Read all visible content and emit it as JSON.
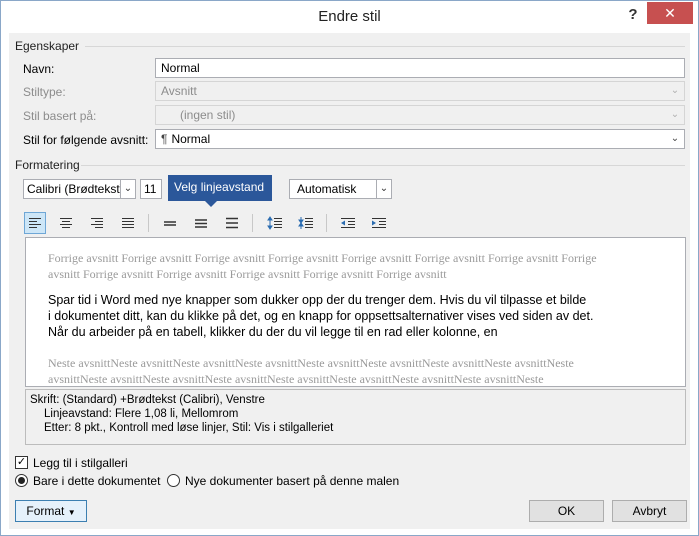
{
  "window": {
    "title": "Endre stil",
    "help_label": "?",
    "close_label": "✕"
  },
  "properties": {
    "section_label": "Egenskaper",
    "name_label": "Navn:",
    "name_value": "Normal",
    "type_label": "Stiltype:",
    "type_value": "Avsnitt",
    "based_on_label": "Stil basert på:",
    "based_on_value": "(ingen stil)",
    "next_label": "Stil for følgende avsnitt:",
    "next_icon": "¶",
    "next_value": "Normal"
  },
  "formatting": {
    "section_label": "Formatering",
    "font_value": "Calibri (Brødtekst)",
    "size_value": "11",
    "color_value": "Automatisk",
    "tooltip": "Velg linjeavstand",
    "toolbar_icons": [
      "align-left-icon",
      "align-center-icon",
      "align-right-icon",
      "justify-icon",
      "single-spacing-icon",
      "one-half-spacing-icon",
      "double-spacing-icon",
      "space-before-increase-icon",
      "space-before-decrease-icon",
      "decrease-indent-icon",
      "increase-indent-icon"
    ]
  },
  "preview": {
    "prev_line1": "Forrige avsnitt Forrige avsnitt Forrige avsnitt Forrige avsnitt Forrige avsnitt Forrige avsnitt Forrige avsnitt Forrige",
    "prev_line2": "avsnitt Forrige avsnitt Forrige avsnitt Forrige avsnitt Forrige avsnitt Forrige avsnitt",
    "main_line1": "Spar tid i Word med nye knapper som dukker opp der du trenger dem. Hvis du vil tilpasse et bilde",
    "main_line2": "i dokumentet ditt, kan du klikke på det, og en knapp for oppsettsalternativer vises ved siden av det.",
    "main_line3": "Når du arbeider på en tabell, klikker du der du vil legge til en rad eller kolonne, en",
    "next_line1": "Neste avsnittNeste avsnittNeste avsnittNeste avsnittNeste avsnittNeste avsnittNeste avsnittNeste avsnittNeste",
    "next_line2": "avsnittNeste avsnittNeste avsnittNeste avsnittNeste avsnittNeste avsnittNeste avsnittNeste avsnittNeste"
  },
  "description": {
    "line1": "Skrift: (Standard) +Brødtekst (Calibri), Venstre",
    "line2": "Linjeavstand:  Flere 1,08 li, Mellomrom",
    "line3": "Etter:  8 pkt., Kontroll med løse linjer, Stil: Vis i stilgalleriet"
  },
  "options": {
    "add_gallery_label": "Legg til i stilgalleri",
    "only_doc_label": "Bare i dette dokumentet",
    "new_docs_label": "Nye dokumenter basert på denne malen"
  },
  "buttons": {
    "format_label": "Format",
    "ok_label": "OK",
    "cancel_label": "Avbryt"
  }
}
